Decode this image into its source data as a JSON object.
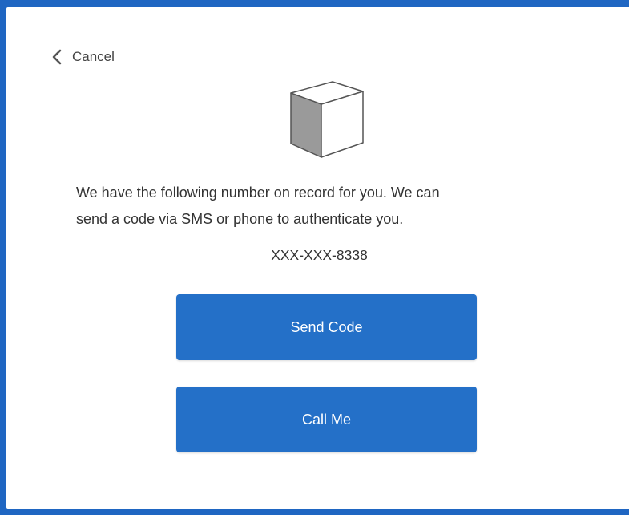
{
  "cancel": {
    "label": "Cancel",
    "icon": "chevron-left-icon"
  },
  "logo": {
    "icon": "cube-icon"
  },
  "message": {
    "line1": "We have the following number on record for you. We can",
    "line2": "send a code via SMS or phone to authenticate you."
  },
  "phone_number": "XXX-XXX-8338",
  "buttons": {
    "send_code": "Send Code",
    "call_me": "Call Me"
  },
  "colors": {
    "accent": "#2470c8",
    "frame": "#1f66c2"
  }
}
